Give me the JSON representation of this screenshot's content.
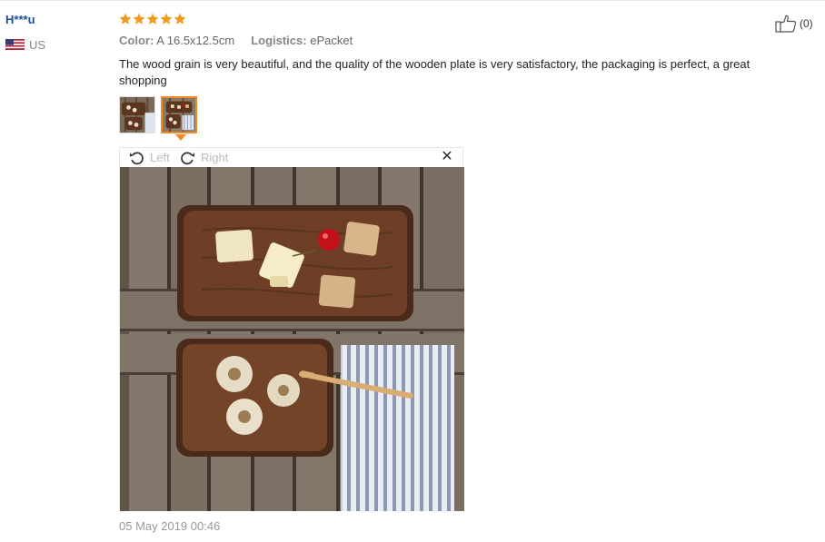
{
  "review": {
    "user": "H***u",
    "country": "US",
    "rating": 5,
    "color_label": "Color:",
    "color_value": "A 16.5x12.5cm",
    "logistics_label": "Logistics:",
    "logistics_value": "ePacket",
    "text": "The wood grain is very beautiful, and the quality of the wooden plate is very satisfactory, the packaging is perfect, a great shopping",
    "likes": "(0)",
    "date": "05 May 2019 00:46"
  },
  "viewer": {
    "rotate_left_label": "Left",
    "rotate_right_label": "Right",
    "close_glyph": "✕"
  },
  "colors": {
    "username": "#1a4f9c",
    "star": "#f39a1c",
    "active_thumb": "#f08a24"
  },
  "icons": [
    "us-flag-icon",
    "star-icon",
    "thumbs-up-icon",
    "rotate-left-icon",
    "rotate-right-icon",
    "close-icon"
  ]
}
